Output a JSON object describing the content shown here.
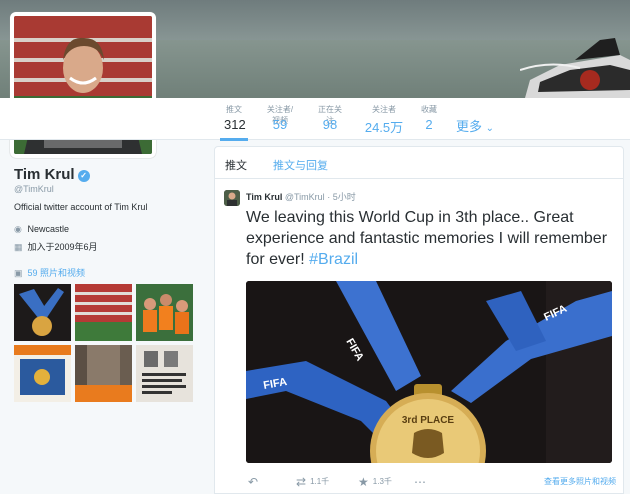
{
  "profile": {
    "name": "Tim Krul",
    "handle": "@TimKrul",
    "bio": "Official twitter account of Tim Krul",
    "location": "Newcastle",
    "joined": "加入于2009年6月",
    "photos_link": "59 照片和视频",
    "verified_icon": "verified-badge-icon"
  },
  "nav": {
    "stats": [
      {
        "label": "推文",
        "value": "312"
      },
      {
        "label": "关注者/视频",
        "value": "59"
      },
      {
        "label": "正在关注",
        "value": "98"
      },
      {
        "label": "关注者",
        "value": "24.5万"
      },
      {
        "label": "收藏",
        "value": "2"
      }
    ],
    "more": "更多"
  },
  "timeline": {
    "tabs": [
      "推文",
      "推文与回复"
    ],
    "tweet": {
      "name": "Tim Krul",
      "handle": "@TimKrul",
      "time": "5小时",
      "text_main": "We leaving this World Cup in 3th place.. Great experience and fantastic memories I will remember for ever! ",
      "hashtag": "#Brazil",
      "medal_label": "3rd PLACE",
      "lanyard_text": "FIFA",
      "retweets": "1.1千",
      "favorites": "1.3千",
      "view_more": "查看更多照片和视频"
    }
  },
  "colors": {
    "accent": "#55acee",
    "text": "#292f33",
    "muted": "#8899a6"
  }
}
